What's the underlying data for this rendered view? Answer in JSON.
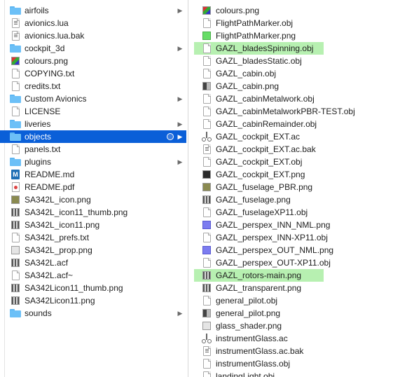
{
  "left_column": {
    "items": [
      {
        "label": "airfoils",
        "icon": "folder-icon",
        "kind": "folder"
      },
      {
        "label": "avionics.lua",
        "icon": "lua-file-icon",
        "kind": "lua"
      },
      {
        "label": "avionics.lua.bak",
        "icon": "lua-file-icon",
        "kind": "lua"
      },
      {
        "label": "cockpit_3d",
        "icon": "folder-icon",
        "kind": "folder"
      },
      {
        "label": "colours.png",
        "icon": "image-icon",
        "kind": "img-colour"
      },
      {
        "label": "COPYING.txt",
        "icon": "text-file-icon",
        "kind": "doc"
      },
      {
        "label": "credits.txt",
        "icon": "text-file-icon",
        "kind": "doc"
      },
      {
        "label": "Custom Avionics",
        "icon": "folder-icon",
        "kind": "folder"
      },
      {
        "label": "LICENSE",
        "icon": "document-icon",
        "kind": "doc"
      },
      {
        "label": "liveries",
        "icon": "folder-icon",
        "kind": "folder"
      },
      {
        "label": "objects",
        "icon": "folder-icon",
        "kind": "folder",
        "selected": true
      },
      {
        "label": "panels.txt",
        "icon": "text-file-icon",
        "kind": "doc"
      },
      {
        "label": "plugins",
        "icon": "folder-icon",
        "kind": "folder"
      },
      {
        "label": "README.md",
        "icon": "markdown-icon",
        "kind": "md"
      },
      {
        "label": "README.pdf",
        "icon": "pdf-icon",
        "kind": "pdf"
      },
      {
        "label": "SA342L_icon.png",
        "icon": "image-icon",
        "kind": "img-olive"
      },
      {
        "label": "SA342L_icon11_thumb.png",
        "icon": "image-icon",
        "kind": "img-pattern"
      },
      {
        "label": "SA342L_icon11.png",
        "icon": "image-icon",
        "kind": "img-pattern"
      },
      {
        "label": "SA342L_prefs.txt",
        "icon": "text-file-icon",
        "kind": "doc"
      },
      {
        "label": "SA342L_prop.png",
        "icon": "image-icon",
        "kind": "img-light"
      },
      {
        "label": "SA342L.acf",
        "icon": "acf-file-icon",
        "kind": "img-pattern"
      },
      {
        "label": "SA342L.acf~",
        "icon": "document-icon",
        "kind": "doc"
      },
      {
        "label": "SA342Licon11_thumb.png",
        "icon": "image-icon",
        "kind": "img-pattern"
      },
      {
        "label": "SA342Licon11.png",
        "icon": "image-icon",
        "kind": "img-pattern"
      },
      {
        "label": "sounds",
        "icon": "folder-icon",
        "kind": "folder"
      }
    ],
    "folder_chevron": "▶"
  },
  "right_column": {
    "items": [
      {
        "label": "colours.png",
        "icon": "image-icon",
        "kind": "img-colour"
      },
      {
        "label": "FlightPathMarker.obj",
        "icon": "document-icon",
        "kind": "doc"
      },
      {
        "label": "FlightPathMarker.png",
        "icon": "image-icon",
        "kind": "img-green"
      },
      {
        "label": "GAZL_bladesSpinning.obj",
        "icon": "document-icon",
        "kind": "doc",
        "highlight": true
      },
      {
        "label": "GAZL_bladesStatic.obj",
        "icon": "document-icon",
        "kind": "doc"
      },
      {
        "label": "GAZL_cabin.obj",
        "icon": "document-icon",
        "kind": "doc"
      },
      {
        "label": "GAZL_cabin.png",
        "icon": "image-icon",
        "kind": "img-mixed"
      },
      {
        "label": "GAZL_cabinMetalwork.obj",
        "icon": "document-icon",
        "kind": "doc"
      },
      {
        "label": "GAZL_cabinMetalworkPBR-TEST.obj",
        "icon": "document-icon",
        "kind": "doc"
      },
      {
        "label": "GAZL_cabinRemainder.obj",
        "icon": "document-icon",
        "kind": "doc"
      },
      {
        "label": "GAZL_cockpit_EXT.ac",
        "icon": "ac-file-icon",
        "kind": "ac"
      },
      {
        "label": "GAZL_cockpit_EXT.ac.bak",
        "icon": "lua-file-icon",
        "kind": "lua"
      },
      {
        "label": "GAZL_cockpit_EXT.obj",
        "icon": "document-icon",
        "kind": "doc"
      },
      {
        "label": "GAZL_cockpit_EXT.png",
        "icon": "image-icon",
        "kind": "img-dark"
      },
      {
        "label": "GAZL_fuselage_PBR.png",
        "icon": "image-icon",
        "kind": "img-olive"
      },
      {
        "label": "GAZL_fuselage.png",
        "icon": "image-icon",
        "kind": "img-pattern"
      },
      {
        "label": "GAZL_fuselageXP11.obj",
        "icon": "document-icon",
        "kind": "doc"
      },
      {
        "label": "GAZL_perspex_INN_NML.png",
        "icon": "image-icon",
        "kind": "img-purple"
      },
      {
        "label": "GAZL_perspex_INN-XP11.obj",
        "icon": "document-icon",
        "kind": "doc"
      },
      {
        "label": "GAZL_perspex_OUT_NML.png",
        "icon": "image-icon",
        "kind": "img-purple"
      },
      {
        "label": "GAZL_perspex_OUT-XP11.obj",
        "icon": "document-icon",
        "kind": "doc"
      },
      {
        "label": "GAZL_rotors-main.png",
        "icon": "image-icon",
        "kind": "img-pattern",
        "highlight": true
      },
      {
        "label": "GAZL_transparent.png",
        "icon": "image-icon",
        "kind": "img-pattern"
      },
      {
        "label": "general_pilot.obj",
        "icon": "document-icon",
        "kind": "doc"
      },
      {
        "label": "general_pilot.png",
        "icon": "image-icon",
        "kind": "img-mixed"
      },
      {
        "label": "glass_shader.png",
        "icon": "image-icon",
        "kind": "img-light"
      },
      {
        "label": "instrumentGlass.ac",
        "icon": "ac-file-icon",
        "kind": "ac"
      },
      {
        "label": "instrumentGlass.ac.bak",
        "icon": "lua-file-icon",
        "kind": "lua"
      },
      {
        "label": "instrumentGlass.obj",
        "icon": "document-icon",
        "kind": "doc"
      },
      {
        "label": "landingLight.obj",
        "icon": "document-icon",
        "kind": "doc"
      }
    ]
  },
  "colors": {
    "selection": "#0a5fd8",
    "highlight": "#b7f0b1",
    "folder": "#6cc0f7"
  }
}
